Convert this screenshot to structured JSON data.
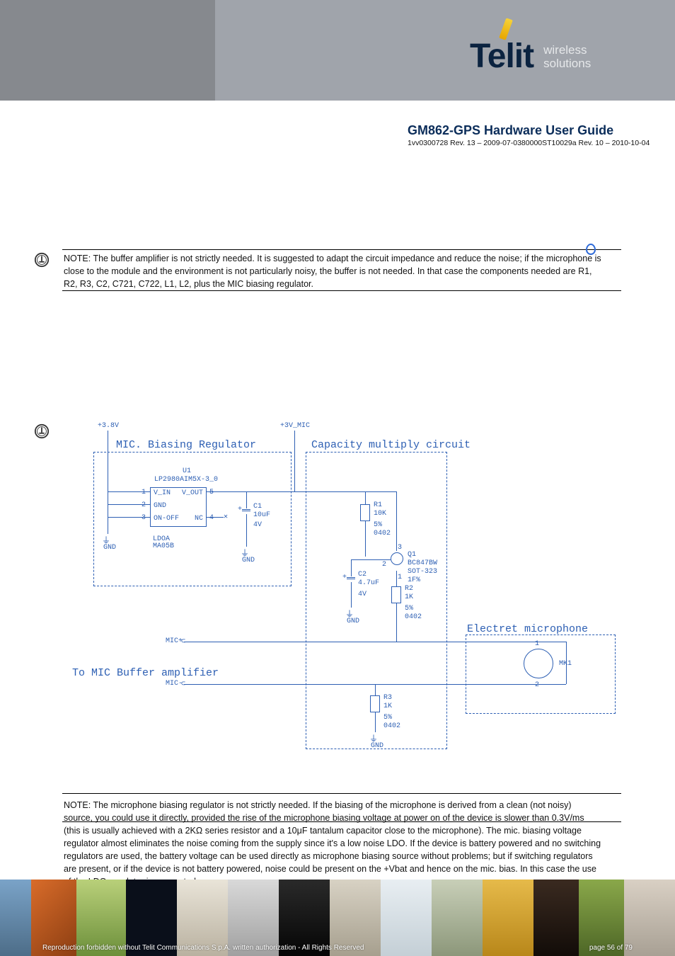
{
  "brand": {
    "name": "Telit",
    "tagline_l1": "wireless",
    "tagline_l2": "solutions"
  },
  "doc": {
    "title": "GM862-GPS Hardware User Guide",
    "doc_ref": "1vv0300728 Rev. 13 – 2009-07-0380000ST10029a Rev. 10 – 2010-10-04"
  },
  "notes": {
    "n1": "NOTE: The buffer amplifier is not strictly needed. It is suggested to adapt the circuit impedance and reduce the noise; if the microphone is close to the module and the environment is not particularly noisy, the buffer is not needed. In that case the components needed are R1, R2, R3, C2, C721, C722, L1, L2, plus the MIC biasing regulator.",
    "n2": "NOTE: The microphone biasing regulator is not strictly needed. If the biasing of the microphone is derived from a clean (not noisy) source, you could use it directly, provided the rise of the microphone biasing voltage at power on of the device is slower than 0.3V/ms (this is usually achieved with a 2KΩ series resistor and a 10μF tantalum capacitor close to the microphone). The mic. biasing voltage regulator almost eliminates the noise coming from the supply since it's a low noise LDO. If the device is battery powered and no switching regulators are used, the battery voltage can be used directly as microphone biasing source without problems; but if switching regulators are present, or if the device is not battery powered, noise could be present on the +Vbat and hence on the mic. bias. In this case the use of the LDO regulator is suggested."
  },
  "diagram": {
    "rail_left": "+3.8V",
    "rail_right": "+3V_MIC",
    "box_bias": "MIC. Biasing Regulator",
    "box_cap": "Capacity multiply circuit",
    "box_mic": "Electret microphone",
    "u1_ref": "U1",
    "u1_part": "LP2980AIM5X-3_0",
    "u1_pins": {
      "p1": "V_IN",
      "p2": "GND",
      "p3": "ON-OFF",
      "p4": "NC",
      "p5": "V_OUT"
    },
    "u1_pkg_l1": "LDOA",
    "u1_pkg_l2": "MA05B",
    "c1_ref": "C1",
    "c1_val": "10uF",
    "c1_v": "4V",
    "c2_ref": "C2",
    "c2_val": "4.7uF",
    "c2_v": "4V",
    "r1_ref": "R1",
    "r1_val": "10K",
    "r1_tol": "5%",
    "r1_pkg": "0402",
    "r2_ref": "R2",
    "r2_val": "1K",
    "r2_tol": "5%",
    "r2_pkg": "0402",
    "r3_ref": "R3",
    "r3_val": "1K",
    "r3_tol": "5%",
    "r3_pkg": "0402",
    "q1_ref": "Q1",
    "q1_part": "BC847BW",
    "q1_pkg": "SOT-323",
    "q1_note": "1F%",
    "mk1": "MK1",
    "gnd": "GND",
    "mic_plus": "MIC+",
    "mic_minus": "MIC-",
    "to_buf": "To MIC Buffer amplifier"
  },
  "footer": {
    "copyright": "Reproduction forbidden without Telit Communications S.p.A. written authorization - All Rights Reserved",
    "page": "page 56 of 79"
  },
  "colors": {
    "brand_navy": "#0b2340",
    "link_blue": "#2d5fb3"
  }
}
